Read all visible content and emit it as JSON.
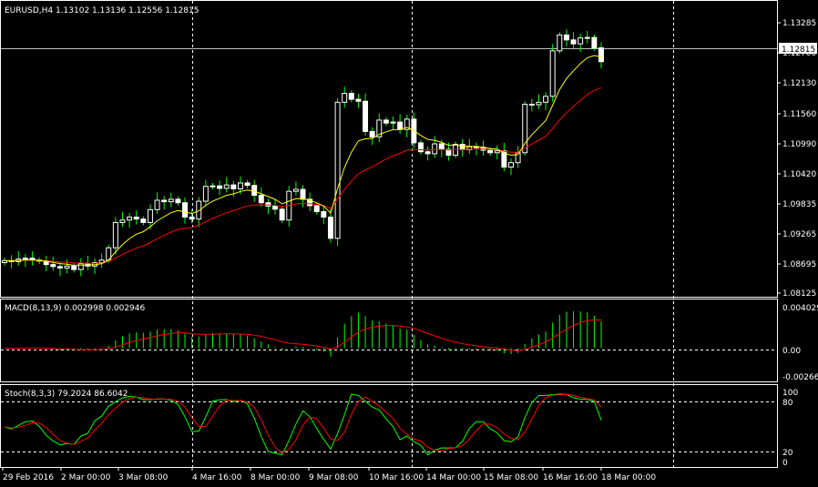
{
  "colors": {
    "background": "#000000",
    "bull": "#ffffff",
    "bear": "#00ff00",
    "wick": "#00ff00",
    "grid": "#ffffff",
    "ma_fast": "#ffff00",
    "ma_slow": "#ff0000",
    "histogram": "#00ff00",
    "signal": "#ff0000",
    "stoch_main": "#00ff00",
    "stoch_signal": "#ff0000"
  },
  "price_panel": {
    "title": "EURUSD,H4  1.13102 1.13136 1.12556 1.12815",
    "current_price_label": "1.12815",
    "scale_labels": [
      "1.13285",
      "1.12700",
      "1.12130",
      "1.11560",
      "1.10990",
      "1.10420",
      "1.09835",
      "1.09265",
      "1.08695",
      "1.08125"
    ]
  },
  "macd_panel": {
    "title": "MACD(8,13,9) 0.002998 0.002946",
    "scale_labels": [
      "0.004029",
      "0.00",
      "-0.002668"
    ]
  },
  "stoch_panel": {
    "title": "Stoch(8,3,3) 79.2024 86.6042",
    "scale_labels": [
      "100",
      "80",
      "20",
      "0"
    ]
  },
  "time_axis": {
    "labels": [
      "29 Feb 2016",
      "2 Mar 00:00",
      "3 Mar 08:00",
      "4 Mar 16:00",
      "8 Mar 00:00",
      "9 Mar 08:00",
      "10 Mar 16:00",
      "14 Mar 00:00",
      "15 Mar 08:00",
      "16 Mar 16:00",
      "18 Mar 00:00"
    ]
  },
  "chart_data": {
    "type": "candlestick",
    "symbol": "EURUSD",
    "timeframe": "H4",
    "x": [
      "29 Feb 2016",
      "2 Mar 00:00",
      "3 Mar 08:00",
      "4 Mar 16:00",
      "8 Mar 00:00",
      "9 Mar 08:00",
      "10 Mar 16:00",
      "14 Mar 00:00",
      "15 Mar 08:00",
      "16 Mar 16:00",
      "18 Mar 00:00"
    ],
    "ylim": [
      1.08125,
      1.1357
    ],
    "last": {
      "open": 1.13102,
      "high": 1.13136,
      "low": 1.12556,
      "close": 1.12815
    },
    "closes": [
      1.088,
      1.0878,
      1.0883,
      1.0885,
      1.0881,
      1.0879,
      1.0872,
      1.0868,
      1.0865,
      1.0869,
      1.0862,
      1.0874,
      1.0869,
      1.0876,
      1.0881,
      1.0906,
      1.0957,
      1.0962,
      1.0968,
      1.0964,
      1.0957,
      1.0983,
      1.1002,
      1.0999,
      1.1004,
      1.0997,
      1.0968,
      1.0964,
      1.1,
      1.103,
      1.1031,
      1.1026,
      1.1033,
      1.1025,
      1.1037,
      1.1032,
      1.1012,
      1.0997,
      1.099,
      1.0984,
      1.0962,
      1.102,
      1.1024,
      1.1004,
      1.0991,
      1.0979,
      1.0968,
      1.0925,
      1.12,
      1.1218,
      1.1206,
      1.1202,
      1.1141,
      1.113,
      1.1164,
      1.1158,
      1.116,
      1.1145,
      1.1166,
      1.1118,
      1.11,
      1.1096,
      1.1116,
      1.1105,
      1.1093,
      1.1115,
      1.1104,
      1.111,
      1.1109,
      1.1103,
      1.1098,
      1.1102,
      1.1069,
      1.1078,
      1.1098,
      1.1196,
      1.1195,
      1.12,
      1.1212,
      1.1304,
      1.1336,
      1.1326,
      1.1318,
      1.133,
      1.1331,
      1.131,
      1.1282
    ],
    "ma_fast": {
      "type": "moving-average",
      "color": "yellow"
    },
    "ma_slow": {
      "type": "moving-average",
      "color": "red"
    },
    "macd": {
      "params": [
        8,
        13,
        9
      ],
      "main": 0.002998,
      "signal": 0.002946,
      "ylim": [
        -0.002668,
        0.004029
      ]
    },
    "stochastic": {
      "params": [
        8,
        3,
        3
      ],
      "main": 79.2024,
      "signal": 86.6042,
      "ylim": [
        0,
        100
      ],
      "levels": [
        20,
        80
      ]
    }
  }
}
